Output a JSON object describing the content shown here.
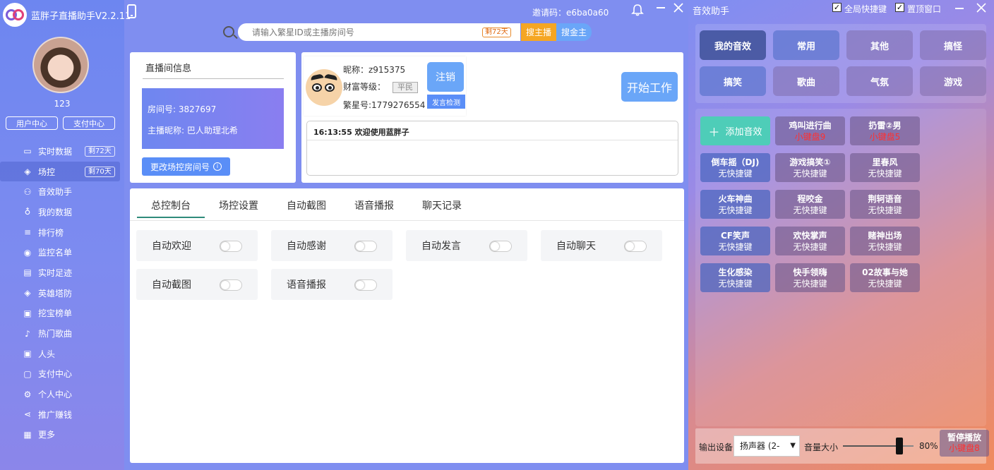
{
  "app": {
    "title": "蓝胖子直播助手V2.2.11",
    "invite_code": "邀请码：e6ba0a60"
  },
  "user": {
    "name": "123",
    "user_center": "用户中心",
    "pay_center": "支付中心"
  },
  "nav": [
    {
      "label": "实时数据",
      "icon": "monitor-icon",
      "glyph": "▭",
      "badge": "剩72天"
    },
    {
      "label": "场控",
      "icon": "gamepad-icon",
      "glyph": "◈",
      "badge": "剩70天",
      "active": true
    },
    {
      "label": "音效助手",
      "icon": "share-icon",
      "glyph": "⚇"
    },
    {
      "label": "我的数据",
      "icon": "microphone-icon",
      "glyph": "♁"
    },
    {
      "label": "排行榜",
      "icon": "ranking-icon",
      "glyph": "≡"
    },
    {
      "label": "监控名单",
      "icon": "target-icon",
      "glyph": "◉"
    },
    {
      "label": "实时足迹",
      "icon": "document-icon",
      "glyph": "▤"
    },
    {
      "label": "英雄塔防",
      "icon": "gamepad-icon",
      "glyph": "◈"
    },
    {
      "label": "挖宝榜单",
      "icon": "gift-icon",
      "glyph": "▣"
    },
    {
      "label": "热门歌曲",
      "icon": "music-note-icon",
      "glyph": "♪"
    },
    {
      "label": "人头",
      "icon": "gift-icon",
      "glyph": "▣"
    },
    {
      "label": "支付中心",
      "icon": "bag-icon",
      "glyph": "▢"
    },
    {
      "label": "个人中心",
      "icon": "gear-icon",
      "glyph": "⚙"
    },
    {
      "label": "推广赚钱",
      "icon": "share-icon",
      "glyph": "⋖"
    },
    {
      "label": "更多",
      "icon": "grid-icon",
      "glyph": "▦"
    }
  ],
  "search": {
    "placeholder": "请输入繁星ID或主播房间号",
    "days_badge": "剩72天",
    "search_host": "搜主播",
    "search_gold": "搜金主"
  },
  "room": {
    "title": "直播间信息",
    "room_no": "房间号: 3827697",
    "host_nick": "主播昵称: 巴人助理北希",
    "change_button": "更改场控房间号"
  },
  "profile": {
    "nickname": "昵称：z915375",
    "wealth_label": "财富等级：",
    "wealth_level": "平民",
    "fanxing_no": "繁星号:1779276554",
    "logout": "注销",
    "speech_check": "发言检测",
    "start_work": "开始工作"
  },
  "log": {
    "time": "16:13:55",
    "message": "欢迎使用蓝胖子"
  },
  "tabs": [
    "总控制台",
    "场控设置",
    "自动截图",
    "语音播报",
    "聊天记录"
  ],
  "switches": [
    {
      "label": "自动欢迎",
      "on": false
    },
    {
      "label": "自动感谢",
      "on": false
    },
    {
      "label": "自动发言",
      "on": false
    },
    {
      "label": "自动聊天",
      "on": false
    },
    {
      "label": "自动截图",
      "on": false
    },
    {
      "label": "语音播报",
      "on": false
    }
  ],
  "sound": {
    "title": "音效助手",
    "global_hotkey": "全局快捷键",
    "always_on_top": "置顶窗口",
    "categories": [
      "我的音效",
      "常用",
      "其他",
      "搞怪",
      "搞笑",
      "歌曲",
      "气氛",
      "游戏"
    ],
    "add_effect": "添加音效",
    "effects": [
      {
        "name": "鸡叫进行曲",
        "key": "小键盘9",
        "red": true
      },
      {
        "name": "扔雷②男",
        "key": "小键盘5",
        "red": true
      },
      {
        "name": "倒车摇（DJ)",
        "key": "无快捷键"
      },
      {
        "name": "游戏搞笑①",
        "key": "无快捷键"
      },
      {
        "name": "里春风",
        "key": "无快捷键"
      },
      {
        "name": "火车神曲",
        "key": "无快捷键"
      },
      {
        "name": "程咬金",
        "key": "无快捷键"
      },
      {
        "name": "荆轲语音",
        "key": "无快捷键"
      },
      {
        "name": "CF笑声",
        "key": "无快捷键"
      },
      {
        "name": "欢快掌声",
        "key": "无快捷键"
      },
      {
        "name": "赌神出场",
        "key": "无快捷键"
      },
      {
        "name": "生化感染",
        "key": "无快捷键"
      },
      {
        "name": "快手领嗨",
        "key": "无快捷键"
      },
      {
        "name": "02故事与她",
        "key": "无快捷键"
      }
    ],
    "output_label": "输出设备",
    "device": "扬声器 (2-",
    "volume_label": "音量大小",
    "volume": 80,
    "volume_text": "80%",
    "pause": "暂停播放",
    "pause_key": "小键盘8"
  },
  "colors": {
    "accent_blue": "#6aa6f8",
    "add_green": "#4ecdb8",
    "search_orange": "#f5a623"
  }
}
